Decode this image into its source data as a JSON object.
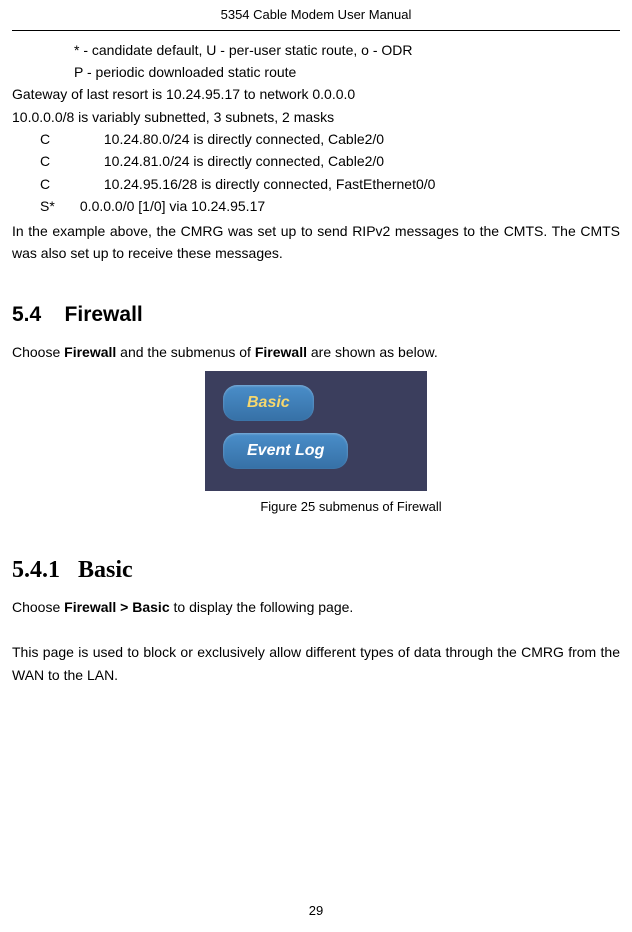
{
  "header": {
    "title": "5354 Cable Modem User Manual"
  },
  "code": {
    "line1": "* - candidate default, U - per-user static route, o - ODR",
    "line2": "P - periodic downloaded static route",
    "line3": "Gateway of last resort is 10.24.95.17 to network 0.0.0.0",
    "line4": "10.0.0.0/8 is variably subnetted, 3 subnets, 2 masks",
    "route1_prefix": "C",
    "route1": "10.24.80.0/24 is directly connected, Cable2/0",
    "route2_prefix": "C",
    "route2": "10.24.81.0/24 is directly connected, Cable2/0",
    "route3_prefix": "C",
    "route3": "10.24.95.16/28 is directly connected, FastEthernet0/0",
    "route4_prefix": "S*",
    "route4": "0.0.0.0/0 [1/0] via 10.24.95.17"
  },
  "para1": "In the example above, the CMRG was set up to send RIPv2 messages to the CMTS. The CMTS was also set up to receive these messages.",
  "section54": {
    "number": "5.4",
    "title": "Firewall",
    "intro_pre": "Choose ",
    "intro_bold1": "Firewall",
    "intro_mid": " and the submenus of ",
    "intro_bold2": "Firewall",
    "intro_post": " are shown as below."
  },
  "submenu": {
    "tab1": "Basic",
    "tab2": "Event Log"
  },
  "figure_caption": "Figure 25 submenus of Firewall",
  "section541": {
    "number": "5.4.1",
    "title": "Basic",
    "intro_pre": "Choose ",
    "intro_bold": "Firewall > Basic",
    "intro_post": " to display the following page.",
    "para": "This page is used to block or exclusively allow different types of data through the CMRG from the WAN to the LAN."
  },
  "footer": {
    "page": "29"
  }
}
